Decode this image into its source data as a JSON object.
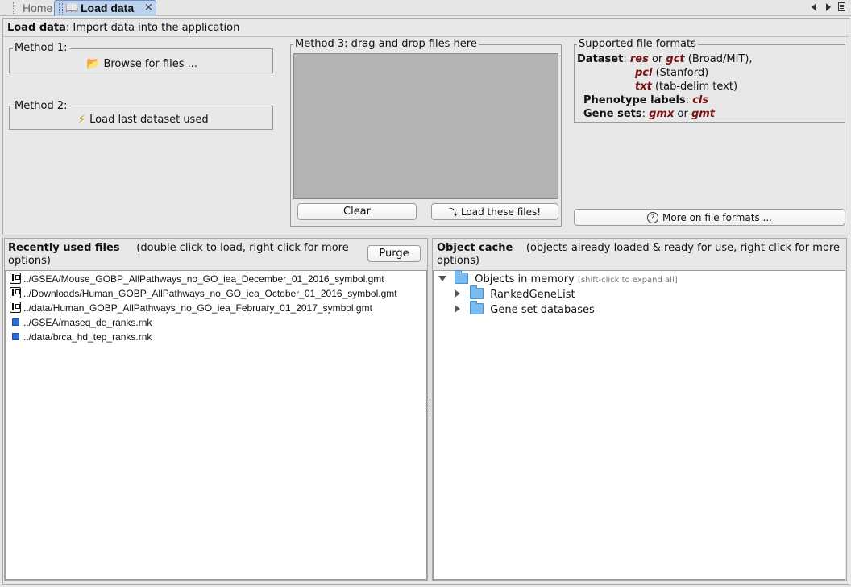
{
  "tabs": {
    "home_label": "Home",
    "active_label": "Load data",
    "close_glyph": "×"
  },
  "header": {
    "title_bold": "Load data",
    "title_rest": ": Import data into the application"
  },
  "method1": {
    "title": "Method 1:",
    "button_label": "Browse for files ..."
  },
  "method2": {
    "title": "Method 2:",
    "button_label": "Load last dataset used"
  },
  "method3": {
    "title": "Method 3: drag and drop files here",
    "clear_label": "Clear",
    "load_label": "Load these files!"
  },
  "formats": {
    "title": "Supported file formats",
    "dataset_label": "Dataset",
    "res": "res",
    "or1": " or ",
    "gct": "gct",
    "gct_desc": " (Broad/MIT),",
    "pcl": "pcl",
    "pcl_desc": " (Stanford)",
    "txt": "txt",
    "txt_desc": " (tab-delim text)",
    "phenotype_label": "Phenotype labels",
    "cls": "cls",
    "genesets_label": "Gene sets",
    "gmx": "gmx",
    "or2": " or ",
    "gmt": "gmt",
    "more_label": "More on file formats ..."
  },
  "recent": {
    "title": "Recently used files",
    "subtitle": "(double click to load, right click for more options)",
    "purge_label": "Purge",
    "files": [
      {
        "name": "../GSEA/Mouse_GOBP_AllPathways_no_GO_iea_December_01_2016_symbol.gmt",
        "icon": "gmt-file-icon"
      },
      {
        "name": "../Downloads/Human_GOBP_AllPathways_no_GO_iea_October_01_2016_symbol.gmt",
        "icon": "gmt-file-icon"
      },
      {
        "name": "../data/Human_GOBP_AllPathways_no_GO_iea_February_01_2017_symbol.gmt",
        "icon": "gmt-file-icon"
      },
      {
        "name": "../GSEA/rnaseq_de_ranks.rnk",
        "icon": "rnk-file-icon"
      },
      {
        "name": "../data/brca_hd_tep_ranks.rnk",
        "icon": "rnk-file-icon"
      }
    ]
  },
  "cache": {
    "title": "Object cache",
    "subtitle": "(objects already loaded & ready for use, right click for more options)",
    "root_label": "Objects in memory",
    "root_hint": "[shift-click to expand all]",
    "children": [
      "RankedGeneList",
      "Gene set databases"
    ]
  },
  "colors": {
    "active_tab": "#bcd1ec",
    "dropzone": "#b3b3b3",
    "format_ext": "#7a1010",
    "rnk_icon": "#2b6fd6",
    "folder": "#7bbcf0"
  }
}
